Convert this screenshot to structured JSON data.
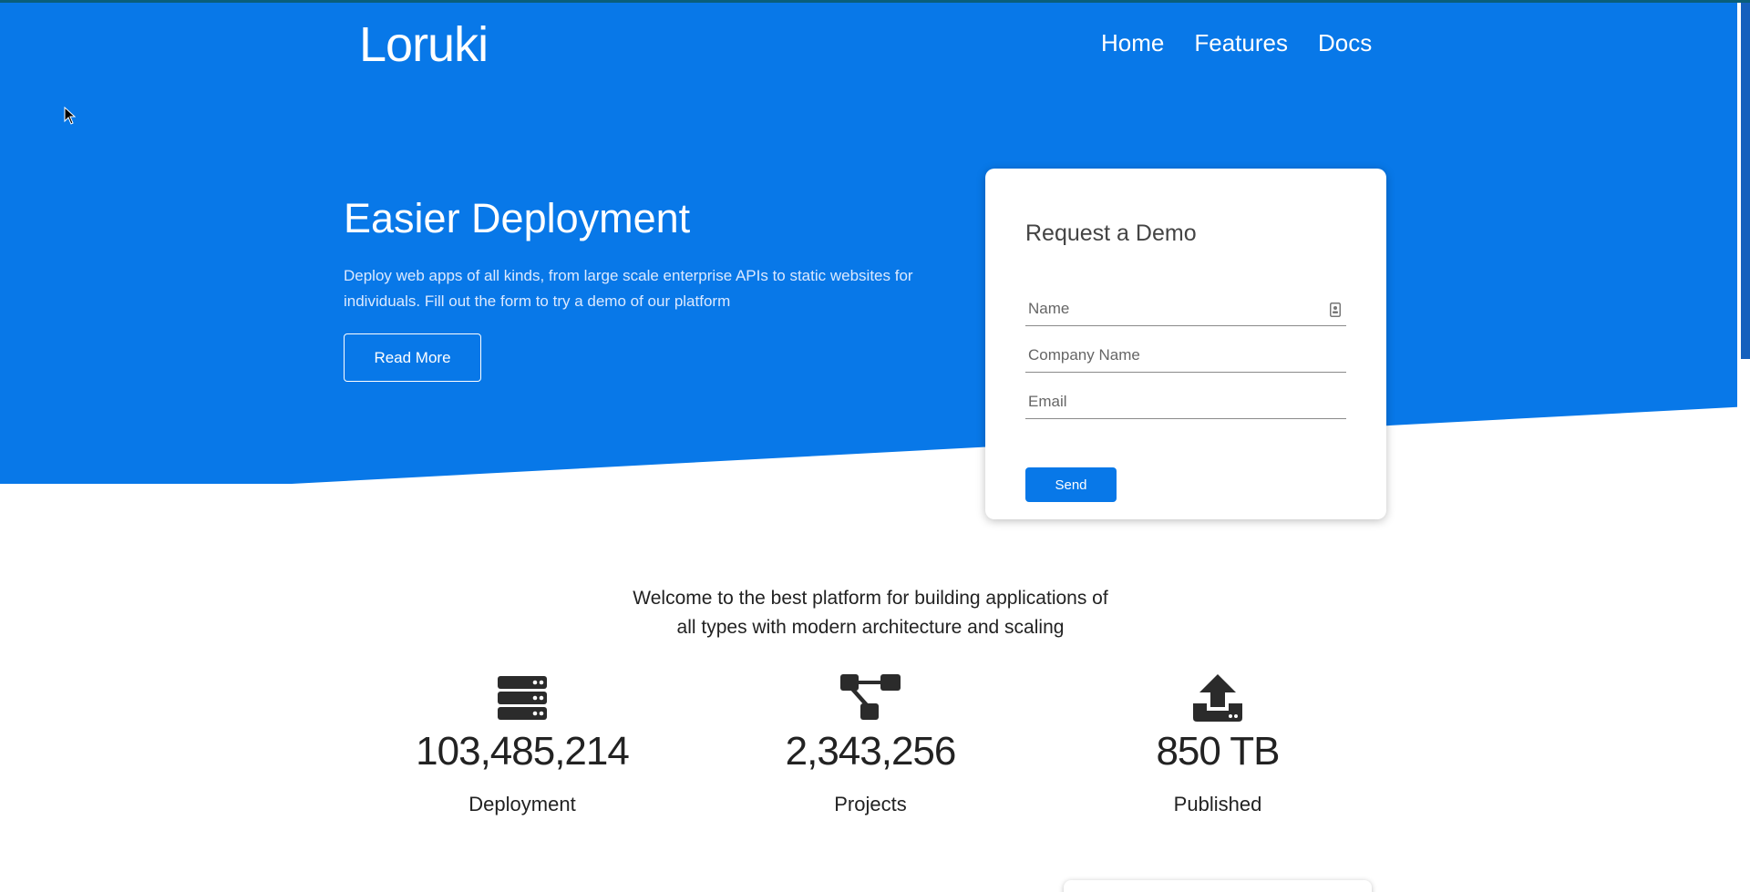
{
  "brand": {
    "logo": "Loruki"
  },
  "nav": {
    "items": [
      {
        "label": "Home"
      },
      {
        "label": "Features"
      },
      {
        "label": "Docs"
      }
    ]
  },
  "hero": {
    "title": "Easier Deployment",
    "description": "Deploy web apps of all kinds, from large scale enterprise APIs to static websites for individuals. Fill out the form to try a demo of our platform",
    "read_more_label": "Read More"
  },
  "form": {
    "title": "Request a Demo",
    "name_placeholder": "Name",
    "name_value": "",
    "company_placeholder": "Company Name",
    "company_value": "",
    "email_placeholder": "Email",
    "email_value": "",
    "send_label": "Send"
  },
  "welcome": {
    "text": "Welcome to the best platform for building applications of all types with modern architecture and scaling"
  },
  "stats": [
    {
      "icon": "server-icon",
      "value": "103,485,214",
      "label": "Deployment"
    },
    {
      "icon": "project-diagram-icon",
      "value": "2,343,256",
      "label": "Projects"
    },
    {
      "icon": "upload-icon",
      "value": "850 TB",
      "label": "Published"
    }
  ],
  "colors": {
    "primary": "#0878e8",
    "text_dark": "#222222",
    "white": "#ffffff"
  }
}
